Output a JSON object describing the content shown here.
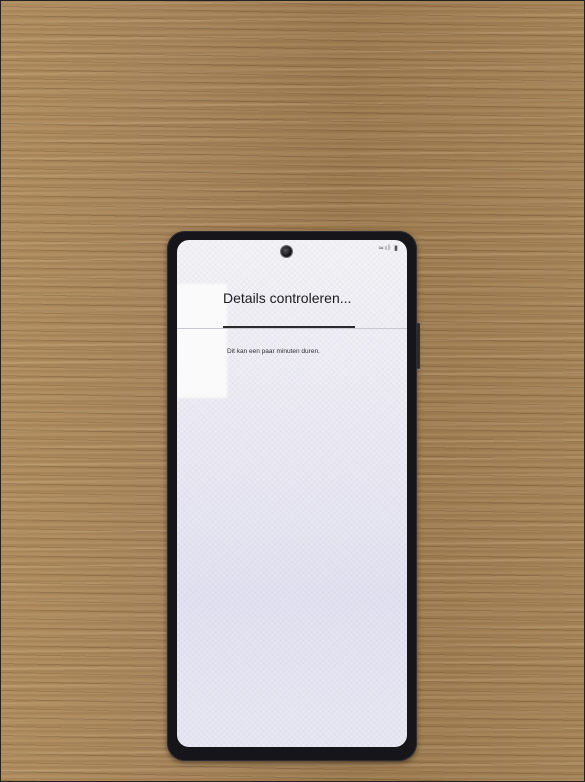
{
  "screen": {
    "title": "Details controleren...",
    "subtitle": "Dit kan een paar minuten duren.",
    "status_icons": "≈ıl ▮"
  },
  "icons": [
    "front-camera-icon",
    "wifi-icon",
    "signal-icon",
    "battery-icon"
  ],
  "colors": {
    "table_wood": "#a48254",
    "phone_body": "#15151a",
    "screen_background": "#ecebf4",
    "text": "#1b1b1e"
  }
}
